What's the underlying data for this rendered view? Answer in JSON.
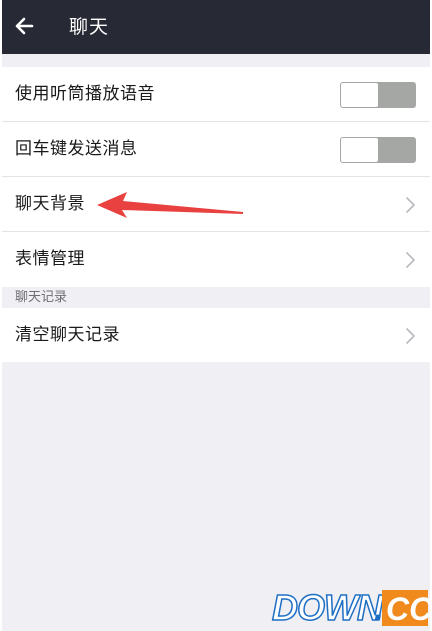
{
  "header": {
    "title": "聊天"
  },
  "settings": [
    {
      "label": "使用听筒播放语音",
      "control": "toggle",
      "on": false
    },
    {
      "label": "回车键发送消息",
      "control": "toggle",
      "on": false
    },
    {
      "label": "聊天背景",
      "control": "chevron"
    },
    {
      "label": "表情管理",
      "control": "chevron"
    }
  ],
  "chat_records": {
    "section_label": "聊天记录",
    "items": [
      {
        "label": "清空聊天记录",
        "control": "chevron"
      }
    ]
  },
  "annotation": {
    "icon": "red-arrow-icon",
    "color": "#e8413f",
    "points_to": "聊天背景"
  },
  "watermark": {
    "text": "DOWN.CC",
    "colors": {
      "primary": "#1e6fc4",
      "accent": "#f08a1c"
    }
  },
  "colors": {
    "header_bg": "#272a35",
    "page_bg": "#efeff4",
    "toggle_off": "#a5a7a4"
  }
}
